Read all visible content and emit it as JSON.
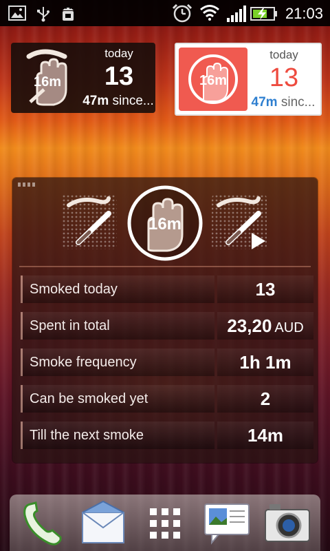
{
  "status_bar": {
    "time": "21:03",
    "icons": [
      "image-icon",
      "usb-icon",
      "android-debug-icon",
      "alarm-icon",
      "wifi-icon",
      "signal-icon",
      "battery-charging-icon"
    ]
  },
  "widget_small_dark": {
    "hand_minutes": "16m",
    "today_label": "today",
    "count": "13",
    "since_value": "47m",
    "since_suffix": " since..."
  },
  "widget_small_light": {
    "hand_minutes": "16m",
    "today_label": "today",
    "count": "13",
    "since_value": "47m",
    "since_suffix": " sinc..."
  },
  "main_widget": {
    "center_minutes": "16m",
    "rows": [
      {
        "label": "Smoked today",
        "value": "13",
        "unit": ""
      },
      {
        "label": "Spent in total",
        "value": "23,20",
        "unit": "AUD"
      },
      {
        "label": "Smoke frequency",
        "value": "1h 1m",
        "unit": ""
      },
      {
        "label": "Can be smoked yet",
        "value": "2",
        "unit": ""
      },
      {
        "label": "Till the next smoke",
        "value": "14m",
        "unit": ""
      }
    ]
  },
  "dock": {
    "items": [
      "phone-icon",
      "mail-icon",
      "app-drawer-icon",
      "messages-icon",
      "camera-icon"
    ]
  },
  "colors": {
    "accent_red": "#ee4b3f",
    "accent_blue": "#2e7fd0"
  }
}
